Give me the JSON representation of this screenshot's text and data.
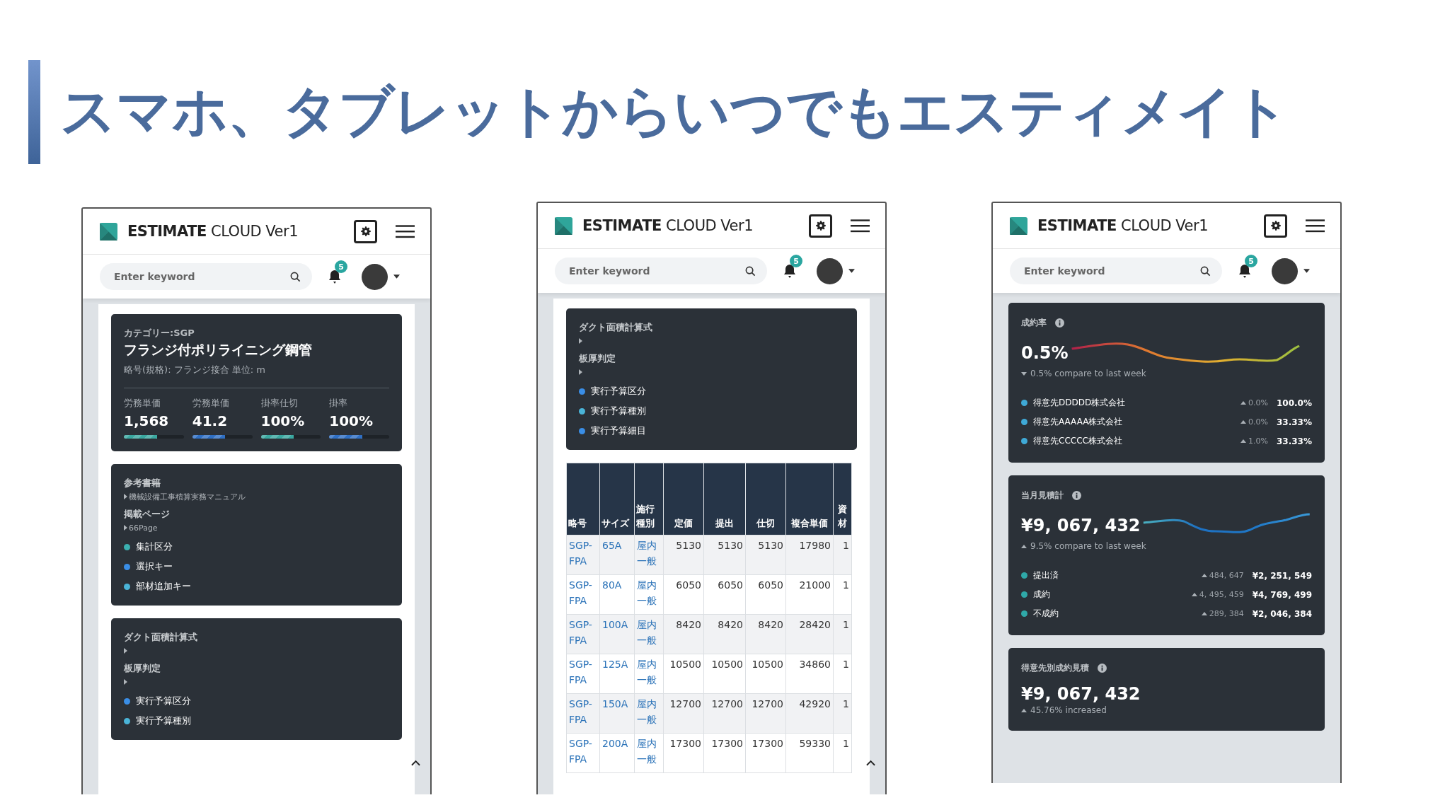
{
  "headline": "スマホ、タブレットからいつでもエスティメイト",
  "phones": [
    {
      "kind": "paneled",
      "brand": "**ESTIMATE** CLOUD Ver1",
      "search": {
        "placeholder": "Enter keyword"
      },
      "notifications": "5",
      "cards": [
        {
          "kind": "product",
          "category": "カテゴリー:SGP",
          "title": "フランジ付ポリライニング鋼管",
          "spec": "略号(規格): フランジ接合 単位: m",
          "stats": [
            {
              "label": "労務単価",
              "value": "1,568",
              "level": 0.55,
              "color": "#3aa8a0"
            },
            {
              "label": "労務単価",
              "value": "41.2",
              "level": 0.55,
              "color": "#2f6fc4"
            },
            {
              "label": "掛率仕切",
              "value": "100%",
              "level": 0.55,
              "color": "#3aa8a0"
            },
            {
              "label": "掛率",
              "value": "100%",
              "level": 0.55,
              "color": "#2f6fc4"
            }
          ]
        },
        {
          "kind": "info",
          "sections": [
            {
              "heading": "参考書籍",
              "value": "機械設備工事積算実務マニュアル"
            },
            {
              "heading": "掲載ページ",
              "value": "66Page"
            }
          ],
          "bullets": [
            {
              "label": "集計区分",
              "color": "#3bb0b0"
            },
            {
              "label": "選択キー",
              "color": "#3a8ee6"
            },
            {
              "label": "部材追加キー",
              "color": "#4ab4d8"
            }
          ]
        },
        {
          "kind": "info",
          "sections": [
            {
              "heading": "ダクト面積計算式"
            },
            {
              "heading": "板厚判定"
            }
          ],
          "bullets": [
            {
              "label": "実行予算区分",
              "color": "#3a8ee6"
            },
            {
              "label": "実行予算種別",
              "color": "#4ab4d8"
            }
          ]
        }
      ]
    },
    {
      "kind": "paneled",
      "brand": "**ESTIMATE** CLOUD Ver1",
      "search": {
        "placeholder": "Enter keyword"
      },
      "notifications": "5",
      "cards": [
        {
          "kind": "info",
          "sections": [
            {
              "heading": "ダクト面積計算式"
            },
            {
              "heading": "板厚判定"
            }
          ],
          "bullets": [
            {
              "label": "実行予算区分",
              "color": "#3a8ee6"
            },
            {
              "label": "実行予算種別",
              "color": "#4ab4d8"
            },
            {
              "label": "実行予算細目",
              "color": "#3a8ee6"
            }
          ]
        },
        {
          "kind": "table",
          "columns": [
            {
              "label": "略号",
              "link": true
            },
            {
              "label": "サイズ",
              "link": true
            },
            {
              "label": "施行種別",
              "link": true
            },
            {
              "label": "定価",
              "link": false
            },
            {
              "label": "提出",
              "link": false
            },
            {
              "label": "仕切",
              "link": false
            },
            {
              "label": "複合単価",
              "link": false
            },
            {
              "label": "資材",
              "link": false
            }
          ],
          "rows": [
            [
              "SGP-FPA",
              "65A",
              "屋内一般",
              "5130",
              "5130",
              "5130",
              "17980",
              "1"
            ],
            [
              "SGP-FPA",
              "80A",
              "屋内一般",
              "6050",
              "6050",
              "6050",
              "21000",
              "1"
            ],
            [
              "SGP-FPA",
              "100A",
              "屋内一般",
              "8420",
              "8420",
              "8420",
              "28420",
              "1"
            ],
            [
              "SGP-FPA",
              "125A",
              "屋内一般",
              "10500",
              "10500",
              "10500",
              "34860",
              "1"
            ],
            [
              "SGP-FPA",
              "150A",
              "屋内一般",
              "12700",
              "12700",
              "12700",
              "42920",
              "1"
            ],
            [
              "SGP-FPA",
              "200A",
              "屋内一般",
              "17300",
              "17300",
              "17300",
              "59330",
              "1"
            ]
          ]
        }
      ]
    },
    {
      "kind": "plain",
      "brand": "**ESTIMATE** CLOUD Ver1",
      "search": {
        "placeholder": "Enter keyword"
      },
      "notifications": "5",
      "cards": [
        {
          "kind": "metric",
          "title": "成約率",
          "value": "0.5%",
          "sparkline": {
            "kind": "warm"
          },
          "change": {
            "up": false,
            "text": "0.5% compare to last week"
          },
          "items": [
            {
              "label": "得意先DDDDD株式会社",
              "color": "#3fa9d6",
              "up": true,
              "change": "0.0%",
              "value": "100.0%"
            },
            {
              "label": "得意先AAAAA株式会社",
              "color": "#3fa9d6",
              "up": true,
              "change": "0.0%",
              "value": "33.33%"
            },
            {
              "label": "得意先CCCCC株式会社",
              "color": "#3fa9d6",
              "up": true,
              "change": "1.0%",
              "value": "33.33%"
            }
          ]
        },
        {
          "kind": "metric",
          "title": "当月見積計",
          "value": "¥9, 067, 432",
          "sparkline": {
            "kind": "cool"
          },
          "change": {
            "up": true,
            "text": "9.5% compare to last week"
          },
          "items": [
            {
              "label": "提出済",
              "color": "#2fa8a8",
              "up": true,
              "change": "484, 647",
              "value": "¥2, 251, 549"
            },
            {
              "label": "成約",
              "color": "#2fa8a8",
              "up": true,
              "change": "4, 495, 459",
              "value": "¥4, 769, 499"
            },
            {
              "label": "不成約",
              "color": "#2fa8a8",
              "up": true,
              "change": "289, 384",
              "value": "¥2, 046, 384"
            }
          ]
        },
        {
          "kind": "metric",
          "title": "得意先別成約見積",
          "value": "¥9, 067, 432",
          "change": {
            "up": true,
            "text": "45.76% increased"
          }
        }
      ]
    }
  ]
}
